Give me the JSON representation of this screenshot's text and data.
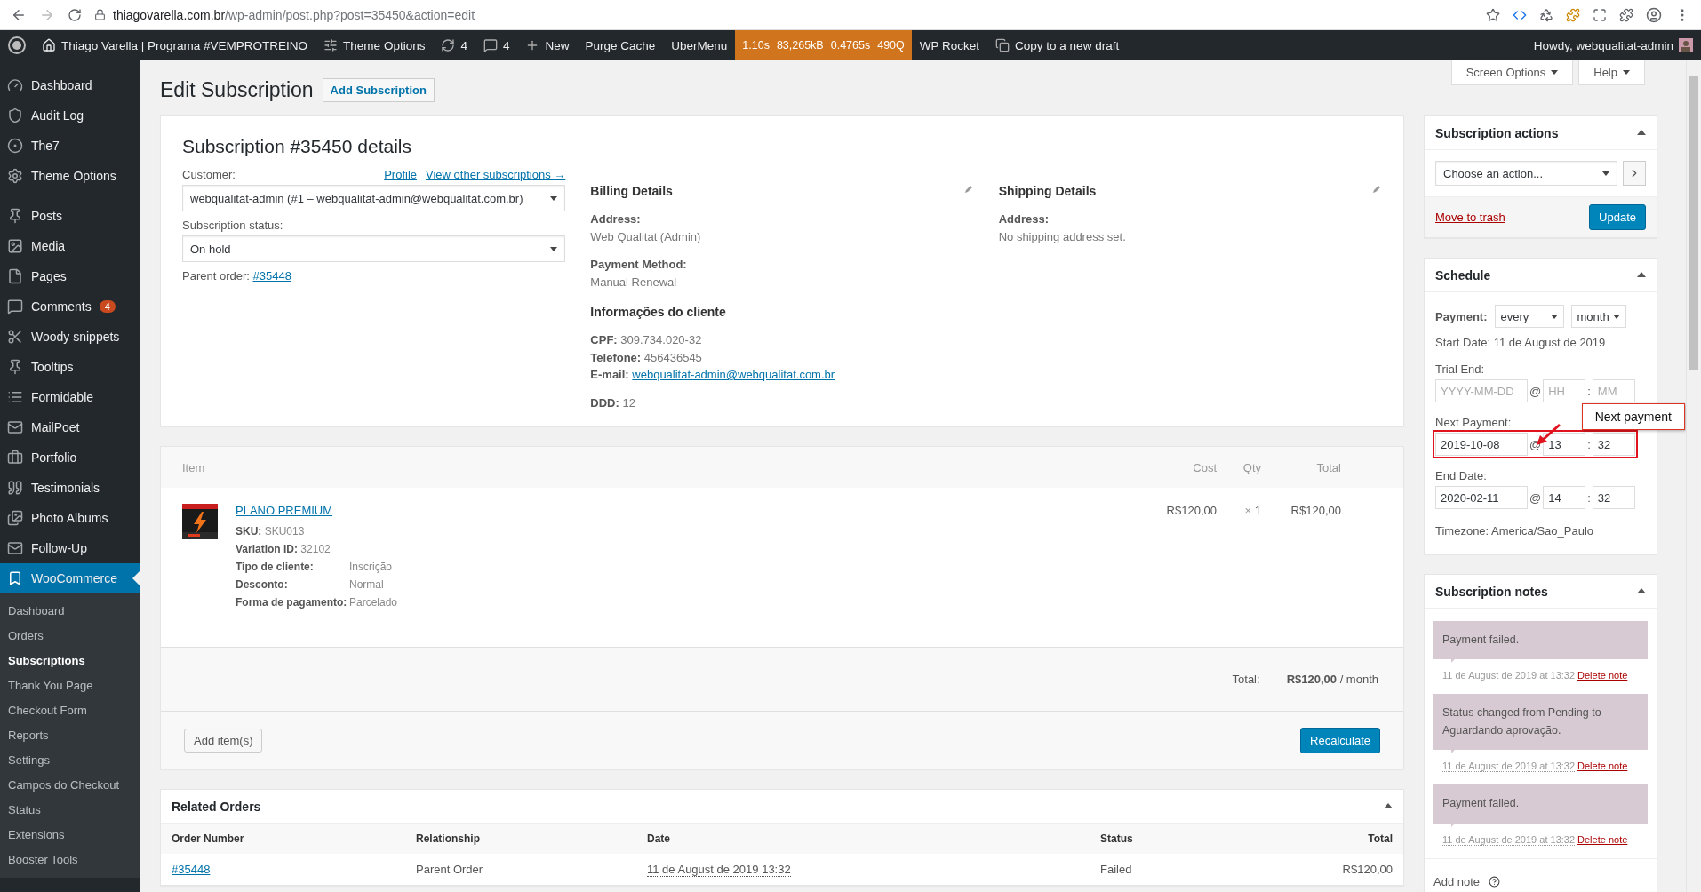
{
  "browser": {
    "url_host": "thiagovarella.com.br",
    "url_path": "/wp-admin/post.php?post=35450&action=edit"
  },
  "admin_bar": {
    "site": "Thiago Varella | Programa #VEMPROTREINO",
    "items": [
      {
        "kind": "theme",
        "label": "Theme Options"
      },
      {
        "kind": "updates",
        "label": "4"
      },
      {
        "kind": "comments",
        "label": "4"
      },
      {
        "kind": "new",
        "label": "New"
      },
      {
        "kind": "text",
        "label": "Purge Cache"
      },
      {
        "kind": "text",
        "label": "UberMenu"
      },
      {
        "kind": "perf",
        "metrics": [
          "1.10s",
          "83,265kB",
          "0.4765s",
          "490Q"
        ]
      },
      {
        "kind": "text",
        "label": "WP Rocket"
      },
      {
        "kind": "copy",
        "label": "Copy to a new draft"
      }
    ],
    "howdy": "Howdy, webqualitat-admin"
  },
  "sidebar": {
    "groups": [
      [
        {
          "label": "Dashboard",
          "selected": false
        },
        {
          "label": "Audit Log",
          "selected": false
        },
        {
          "label": "The7",
          "selected": false
        },
        {
          "label": "Theme Options",
          "selected": false
        }
      ],
      [
        {
          "label": "Posts",
          "selected": false
        },
        {
          "label": "Media",
          "selected": false
        },
        {
          "label": "Pages",
          "selected": false
        },
        {
          "label": "Comments",
          "badge": "4",
          "selected": false
        },
        {
          "label": "Woody snippets",
          "selected": false
        },
        {
          "label": "Tooltips",
          "selected": false
        },
        {
          "label": "Formidable",
          "selected": false
        },
        {
          "label": "MailPoet",
          "selected": false
        },
        {
          "label": "Portfolio",
          "selected": false
        },
        {
          "label": "Testimonials",
          "selected": false
        },
        {
          "label": "Photo Albums",
          "selected": false
        },
        {
          "label": "Follow-Up",
          "selected": false
        },
        {
          "label": "WooCommerce",
          "selected": true,
          "children": [
            {
              "label": "Dashboard",
              "selected": false
            },
            {
              "label": "Orders",
              "selected": false
            },
            {
              "label": "Subscriptions",
              "selected": true
            },
            {
              "label": "Thank You Page",
              "selected": false
            },
            {
              "label": "Checkout Form",
              "selected": false
            },
            {
              "label": "Reports",
              "selected": false
            },
            {
              "label": "Settings",
              "selected": false
            },
            {
              "label": "Campos do Checkout",
              "selected": false
            },
            {
              "label": "Status",
              "selected": false
            },
            {
              "label": "Extensions",
              "selected": false
            },
            {
              "label": "Booster Tools",
              "selected": false
            }
          ]
        }
      ]
    ]
  },
  "screen_tabs": [
    "Screen Options",
    "Help"
  ],
  "page": {
    "title": "Edit Subscription",
    "add_button": "Add Subscription"
  },
  "details": {
    "title": "Subscription #35450 details",
    "customer_label": "Customer:",
    "profile_link": "Profile",
    "other_link": "View other subscriptions →",
    "customer": "webqualitat-admin (#1 – webqualitat-admin@webqualitat.com.br)",
    "status_label": "Subscription status:",
    "status": "On hold",
    "parent_label": "Parent order:",
    "parent_link": "#35448",
    "billing": {
      "title": "Billing Details",
      "fields": [
        {
          "label": "Address:",
          "value": "Web Qualitat (Admin)"
        },
        {
          "label": "Payment Method:",
          "value": "Manual Renewal"
        }
      ],
      "extra_title": "Informações do cliente",
      "extra": [
        [
          {
            "label": "CPF:",
            "value": "309.734.020-32"
          },
          {
            "label": "Telefone:",
            "value": "456436545"
          },
          {
            "label": "E-mail:",
            "value": "webqualitat-admin@webqualitat.com.br",
            "kind": "link"
          }
        ],
        [
          {
            "label": "DDD:",
            "value": "12"
          }
        ]
      ]
    },
    "shipping": {
      "title": "Shipping Details",
      "fields": [
        {
          "label": "Address:",
          "value": "No shipping address set."
        }
      ]
    }
  },
  "items": {
    "columns": [
      "Item",
      "Cost",
      "Qty",
      "Total"
    ],
    "rows": [
      {
        "name": "PLANO PREMIUM",
        "meta": [
          {
            "label": "SKU:",
            "value": "SKU013"
          },
          {
            "label": "Variation ID:",
            "value": "32102"
          }
        ],
        "attrs": [
          {
            "label": "Tipo de cliente:",
            "value": "Inscrição"
          },
          {
            "label": "Desconto:",
            "value": "Normal"
          },
          {
            "label": "Forma de pagamento:",
            "value": "Parcelado"
          }
        ],
        "cost": "R$120,00",
        "qty_mark": "×",
        "qty": "1",
        "total": "R$120,00"
      }
    ],
    "total_label": "Total:",
    "total_value": "R$120,00",
    "total_period": "/ month",
    "add_button": "Add item(s)",
    "recalc_button": "Recalculate"
  },
  "related": {
    "title": "Related Orders",
    "columns": [
      "Order Number",
      "Relationship",
      "Date",
      "Status",
      "Total"
    ],
    "rows": [
      {
        "number": "#35448",
        "relationship": "Parent Order",
        "date": "11 de August de 2019 13:32",
        "status": "Failed",
        "total": "R$120,00"
      }
    ]
  },
  "actions": {
    "title": "Subscription actions",
    "select": "Choose an action...",
    "trash": "Move to trash",
    "update": "Update"
  },
  "schedule": {
    "title": "Schedule",
    "payment_label": "Payment:",
    "interval": "every",
    "period": "month",
    "start_label": "Start Date:",
    "start": "11 de August de 2019",
    "dates": [
      {
        "label": "Trial End:",
        "at": "@",
        "sep": ":",
        "date": {
          "placeholder": "YYYY-MM-DD"
        },
        "hour": {
          "placeholder": "HH"
        },
        "minute": {
          "placeholder": "MM"
        }
      },
      {
        "label": "Next Payment:",
        "at": "@",
        "sep": ":",
        "date": {
          "value": "2019-10-08"
        },
        "hour": {
          "value": "13"
        },
        "minute": {
          "value": "32"
        },
        "annotation": "Next payment"
      },
      {
        "label": "End Date:",
        "at": "@",
        "sep": ":",
        "date": {
          "value": "2020-02-11"
        },
        "hour": {
          "value": "14"
        },
        "minute": {
          "value": "32"
        }
      }
    ],
    "timezone": "Timezone: America/Sao_Paulo"
  },
  "notes": {
    "title": "Subscription notes",
    "items": [
      {
        "text": "Payment failed.",
        "date": "11 de August de 2019 at 13:32",
        "delete": "Delete note"
      },
      {
        "text": "Status changed from Pending to Aguardando aprovação.",
        "date": "11 de August de 2019 at 13:32",
        "delete": "Delete note"
      },
      {
        "text": "Payment failed.",
        "date": "11 de August de 2019 at 13:32",
        "delete": "Delete note"
      }
    ],
    "add_label": "Add note"
  }
}
